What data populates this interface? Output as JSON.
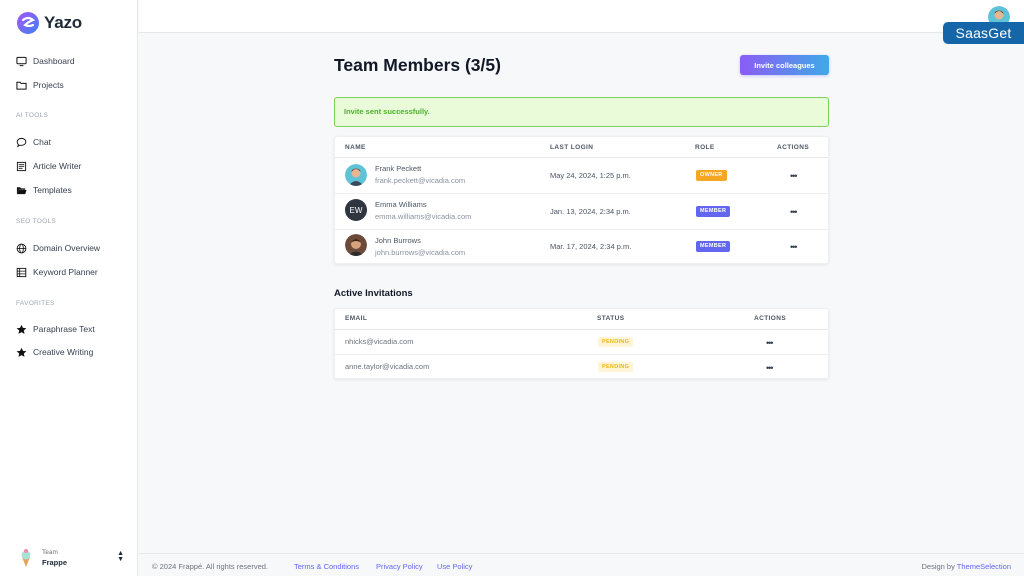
{
  "brand": {
    "name": "Yazo",
    "overlay": "SaasGet"
  },
  "sidebar": {
    "items": [
      {
        "label": "Dashboard",
        "icon": "monitor-icon"
      },
      {
        "label": "Projects",
        "icon": "folder-icon"
      },
      {
        "label": "Chat",
        "icon": "chat-bubble-icon"
      },
      {
        "label": "Article Writer",
        "icon": "article-icon"
      },
      {
        "label": "Templates",
        "icon": "folder-open-icon"
      },
      {
        "label": "Domain Overview",
        "icon": "globe-icon"
      },
      {
        "label": "Keyword Planner",
        "icon": "list-icon"
      },
      {
        "label": "Paraphrase Text",
        "icon": "star-icon"
      },
      {
        "label": "Creative Writing",
        "icon": "star-icon"
      }
    ],
    "sections": [
      "AI TOOLS",
      "SEO TOOLS",
      "FAVORITES"
    ],
    "team": {
      "label": "Team",
      "name": "Frappe"
    }
  },
  "page": {
    "title": "Team Members (3/5)",
    "invite_button": "Invite colleagues",
    "alert": "Invite sent successfully."
  },
  "members": {
    "headers": [
      "NAME",
      "LAST LOGIN",
      "ROLE",
      "ACTIONS"
    ],
    "rows": [
      {
        "name": "Frank Peckett",
        "email": "frank.peckett@vicadia.com",
        "last_login": "May 24, 2024, 1:25 p.m.",
        "role": "OWNER",
        "actions": "•••"
      },
      {
        "name": "Emma Williams",
        "email": "emma.williams@vicadia.com",
        "last_login": "Jan. 13, 2024, 2:34 p.m.",
        "role": "MEMBER",
        "initials": "EW",
        "actions": "•••"
      },
      {
        "name": "John Burrows",
        "email": "john.burrows@vicadia.com",
        "last_login": "Mar. 17, 2024, 2:34 p.m.",
        "role": "MEMBER",
        "actions": "•••"
      }
    ]
  },
  "invitations": {
    "title": "Active Invitations",
    "headers": [
      "EMAIL",
      "STATUS",
      "ACTIONS"
    ],
    "rows": [
      {
        "email": "nhicks@vicadia.com",
        "status": "PENDING",
        "actions": "•••"
      },
      {
        "email": "anne.taylor@vicadia.com",
        "status": "PENDING",
        "actions": "•••"
      }
    ]
  },
  "footer": {
    "copyright": "© 2024 Frappé. All rights reserved.",
    "links": [
      "Terms & Conditions",
      "Privacy Policy",
      "Use Policy"
    ],
    "design_prefix": "Design by",
    "design_brand": "ThemeSelection"
  },
  "colors": {
    "accent": "#6366f1",
    "owner": "#f5a623",
    "success_bg": "#e9fbd8",
    "success_border": "#7cd35a",
    "pending_bg": "#fff4d6",
    "overlay_bg": "#1466a8"
  }
}
